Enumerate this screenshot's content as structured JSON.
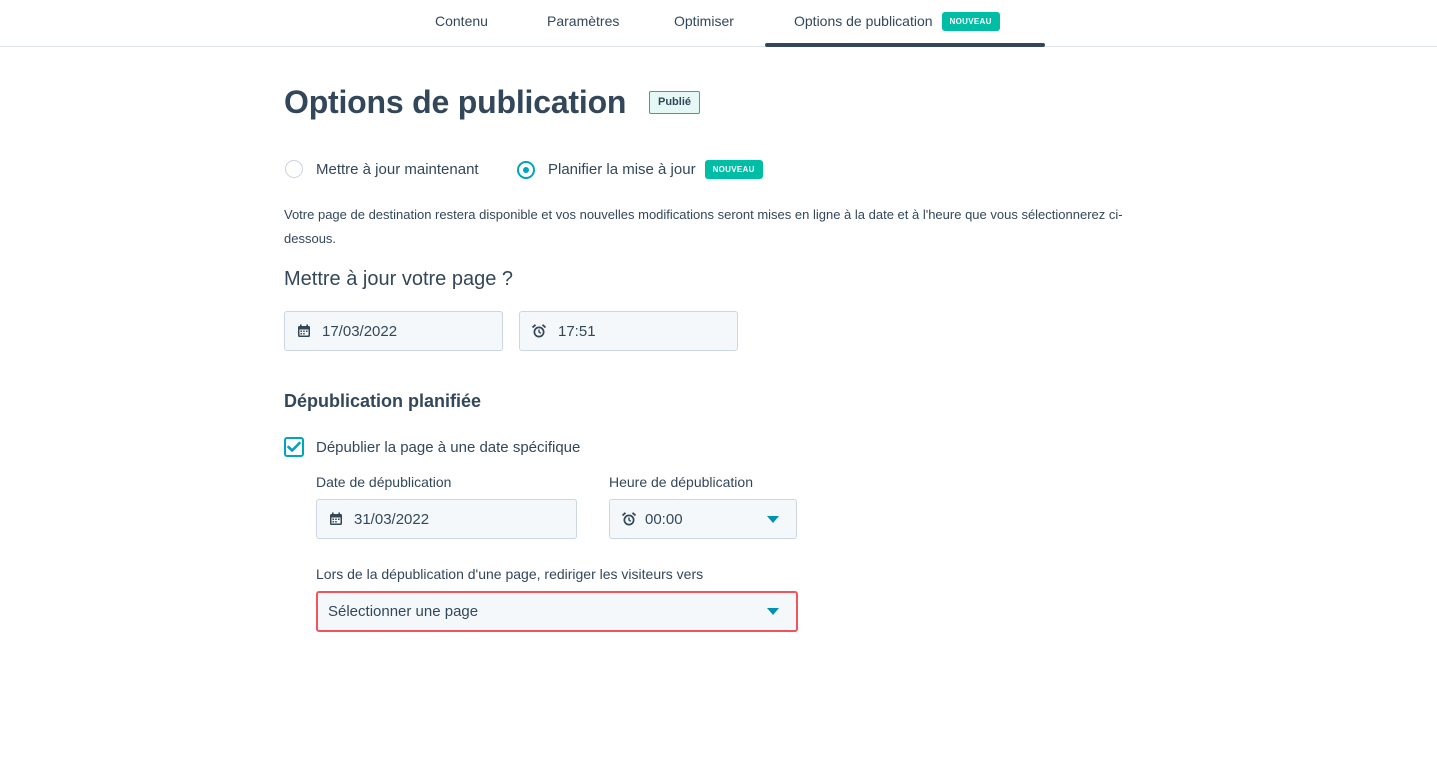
{
  "tabs": [
    {
      "label": "Contenu"
    },
    {
      "label": "Paramètres"
    },
    {
      "label": "Optimiser"
    },
    {
      "label": "Options de publication",
      "badge": "NOUVEAU",
      "active": true
    }
  ],
  "page_title": "Options de publication",
  "status_badge": "Publié",
  "publish_mode": {
    "options": [
      {
        "label": "Mettre à jour maintenant",
        "selected": false
      },
      {
        "label": "Planifier la mise à jour",
        "selected": true,
        "badge": "NOUVEAU"
      }
    ]
  },
  "description": "Votre page de destination restera disponible et vos nouvelles modifications seront mises en ligne à la date et à l'heure que vous sélectionnerez ci-dessous.",
  "update_section": {
    "title": "Mettre à jour votre page ?",
    "date": "17/03/2022",
    "time": "17:51"
  },
  "unpublish_section": {
    "title": "Dépublication planifiée",
    "checkbox_label": "Dépublier la page à une date spécifique",
    "checked": true,
    "date_label": "Date de dépublication",
    "date_value": "31/03/2022",
    "time_label": "Heure de dépublication",
    "time_value": "00:00",
    "redirect_label": "Lors de la dépublication d'une page, rediriger les visiteurs vers",
    "redirect_placeholder": "Sélectionner une page"
  },
  "colors": {
    "accent": "#00a4bd",
    "badge_green": "#00bda5",
    "text": "#33475b",
    "error": "#f2545b"
  },
  "icons": [
    "calendar-icon",
    "alarm-clock-icon",
    "caret-down-icon",
    "checkmark-icon"
  ]
}
